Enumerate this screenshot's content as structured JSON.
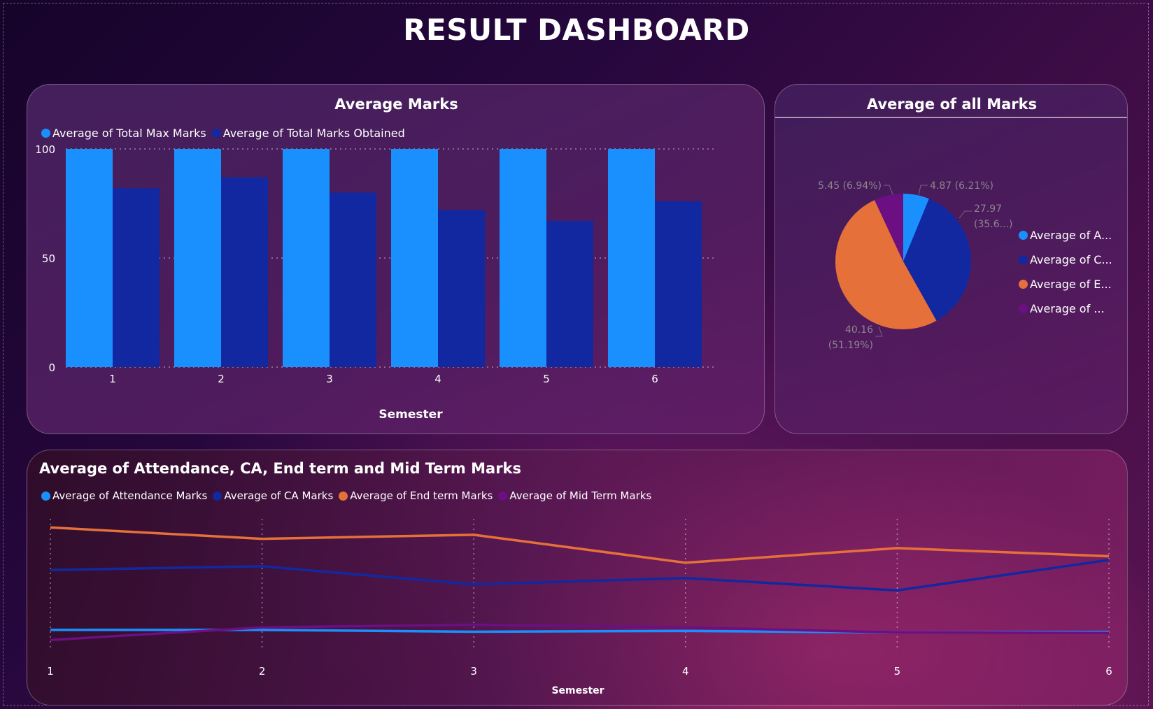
{
  "dashboard_title": "RESULT DASHBOARD",
  "colors": {
    "light_blue": "#1a90ff",
    "dark_blue": "#1228a0",
    "orange": "#e5703a",
    "purple": "#6b0f82"
  },
  "chart_data": [
    {
      "type": "bar",
      "title": "Average Marks",
      "xlabel": "Semester",
      "ylabel": "",
      "categories": [
        "1",
        "2",
        "3",
        "4",
        "5",
        "6"
      ],
      "series": [
        {
          "name": "Average of Total Max Marks",
          "values": [
            100,
            100,
            100,
            100,
            100,
            100
          ],
          "color": "#1a90ff"
        },
        {
          "name": "Average of Total Marks Obtained",
          "values": [
            82,
            87,
            80,
            72,
            67,
            76
          ],
          "color": "#1228a0"
        }
      ],
      "yticks": [
        "0",
        "50",
        "100"
      ],
      "ylim": [
        0,
        100
      ],
      "grid": true,
      "legend": "top-left"
    },
    {
      "type": "pie",
      "title": "Average of all Marks",
      "slices": [
        {
          "legend_label": "Average of A...",
          "value": 4.87,
          "label": "4.87 (6.21%)",
          "color": "#1a90ff"
        },
        {
          "legend_label": "Average of C...",
          "value": 27.97,
          "label_line1": "27.97",
          "label_line2": "(35.6...)",
          "color": "#1228a0"
        },
        {
          "legend_label": "Average of E...",
          "value": 40.16,
          "label_line1": "40.16",
          "label_line2": "(51.19%)",
          "color": "#e5703a"
        },
        {
          "legend_label": "Average of ...",
          "value": 5.45,
          "label": "5.45 (6.94%)",
          "color": "#6b0f82"
        }
      ],
      "legend": "right"
    },
    {
      "type": "line",
      "title": "Average of Attendance, CA, End term and Mid Term Marks",
      "xlabel": "Semester",
      "x": [
        "1",
        "2",
        "3",
        "4",
        "5",
        "6"
      ],
      "series": [
        {
          "name": "Average of Attendance Marks",
          "values": [
            5.3,
            5.3,
            4.6,
            4.9,
            4.3,
            4.5
          ],
          "color": "#1a90ff"
        },
        {
          "name": "Average of CA Marks",
          "values": [
            29.1,
            30.6,
            23.4,
            25.9,
            21.0,
            33.1
          ],
          "color": "#1228a0"
        },
        {
          "name": "Average of End term Marks",
          "values": [
            46.0,
            41.5,
            43.1,
            32.0,
            37.8,
            34.6
          ],
          "color": "#e5703a"
        },
        {
          "name": "Average of Mid Term Marks",
          "values": [
            1.3,
            6.3,
            7.4,
            6.3,
            4.3,
            4.1
          ],
          "color": "#6b0f82"
        }
      ],
      "ylim": [
        0,
        50
      ],
      "grid": true,
      "legend": "top-left"
    }
  ]
}
